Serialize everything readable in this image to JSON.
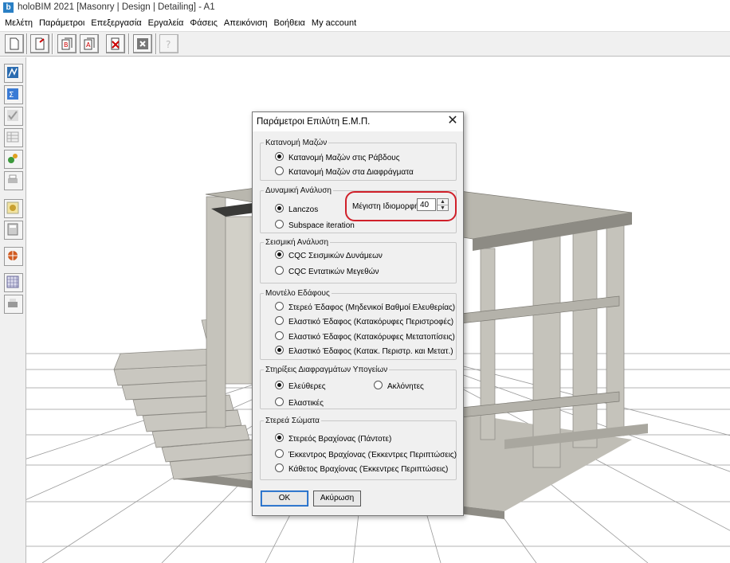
{
  "window": {
    "title": "holoBIM 2021 [Masonry | Design | Detailing] - A1",
    "app_icon": "b"
  },
  "menu": [
    "Μελέτη",
    "Παράμετροι",
    "Επεξεργασία",
    "Εργαλεία",
    "Φάσεις",
    "Απεικόνιση",
    "Βοήθεια",
    "My account"
  ],
  "toolbar_icons": [
    "new-file-icon",
    "open-file-icon",
    "pdf-b-icon",
    "pdf-a-icon",
    "delete-file-icon",
    "close-x-icon",
    "help-icon"
  ],
  "side_icons": [
    "model-icon",
    "sum-icon",
    "check-icon",
    "table-icon",
    "gears-icon",
    "print-icon",
    "tape-icon",
    "calc-icon",
    "globe-icon",
    "grid-icon",
    "printer-icon"
  ],
  "dialog": {
    "title": "Παράμετροι Επιλύτη Ε.Μ.Π.",
    "close": "✕",
    "mass": {
      "legend": "Κατανομή Μαζών",
      "options": [
        "Κατανομή Μαζών στις Ράβδους",
        "Κατανομή Μαζών στα Διαφράγματα"
      ],
      "selected": 0
    },
    "dynamic": {
      "legend": "Δυναμική Ανάλυση",
      "options": [
        "Lanczos",
        "Subspace iteration"
      ],
      "selected": 0,
      "max_mode_label": "Μέγιστη Ιδιομορφή",
      "max_mode_value": "40"
    },
    "seismic": {
      "legend": "Σεισμική Ανάλυση",
      "options": [
        "CQC Σεισμικών Δυνάμεων",
        "CQC Εντατικών Μεγεθών"
      ],
      "selected": 0
    },
    "soil": {
      "legend": "Μοντέλο Εδάφους",
      "options": [
        "Στερεό Έδαφος (Μηδενικοί Βαθμοί Ελευθερίας)",
        "Ελαστικό Έδαφος (Κατακόρυφες Περιστροφές)",
        "Ελαστικό Έδαφος (Κατακόρυφες Μετατοπίσεις)",
        "Ελαστικό Έδαφος (Κατακ. Περιστρ. και  Μετατ.)"
      ],
      "selected": 3
    },
    "supports": {
      "legend": "Στηρίξεις Διαφραγμάτων Υπογείων",
      "options": [
        "Ελεύθερες",
        "Ακλόνητες",
        "Ελαστικές"
      ],
      "selected": 0
    },
    "solids": {
      "legend": "Στερεά Σώματα",
      "options": [
        "Στερεός Βραχίονας (Πάντοτε)",
        "Έκκεντρος Βραχίονας (Έκκεντρες Περιπτώσεις)",
        "Κάθετος Βραχίονας (Έκκεντρες Περιπτώσεις)"
      ],
      "selected": 0
    },
    "ok_label": "OK",
    "cancel_label": "Ακύρωση"
  },
  "colors": {
    "highlight": "#d0202a",
    "grid": "#9a9a9a",
    "concrete": "#c9c7c0"
  }
}
